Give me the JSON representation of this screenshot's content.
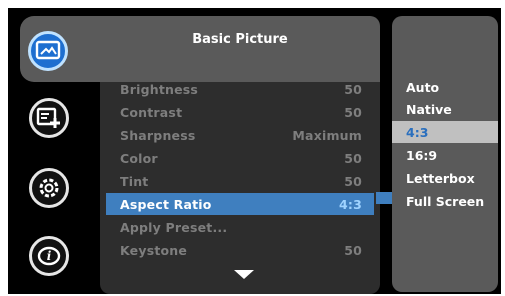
{
  "menu": {
    "title": "Basic Picture",
    "icons": [
      "picture-icon",
      "picture-plus-icon",
      "settings-gear-icon",
      "info-icon"
    ],
    "items": [
      {
        "label": "Brightness",
        "value": "50"
      },
      {
        "label": "Contrast",
        "value": "50"
      },
      {
        "label": "Sharpness",
        "value": "Maximum"
      },
      {
        "label": "Color",
        "value": "50"
      },
      {
        "label": "Tint",
        "value": "50"
      },
      {
        "label": "Aspect Ratio",
        "value": "4:3",
        "selected": true
      },
      {
        "label": "Apply Preset...",
        "value": ""
      },
      {
        "label": "Keystone",
        "value": "50"
      }
    ],
    "scroll_indicator": "chevron-down-icon"
  },
  "aspect_options": {
    "items": [
      "Auto",
      "Native",
      "4:3",
      "16:9",
      "Letterbox",
      "Full Screen"
    ],
    "current": "4:3"
  },
  "colors": {
    "accent": "#3f7fbf",
    "panel": "#5a5a5a",
    "body": "#2d2d2d",
    "highlight": "#c0c0c0"
  }
}
